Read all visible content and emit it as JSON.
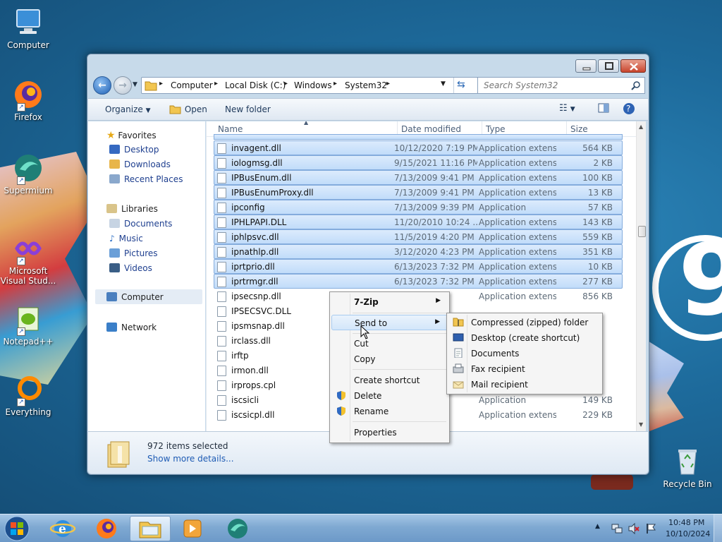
{
  "desktop": {
    "icons": [
      {
        "label": "Computer"
      },
      {
        "label": "Firefox"
      },
      {
        "label": "Supermium"
      },
      {
        "label": "Microsoft Visual Stud..."
      },
      {
        "label": "Notepad++"
      },
      {
        "label": "Everything"
      },
      {
        "label": "Recycle Bin"
      }
    ]
  },
  "window": {
    "breadcrumb": [
      "Computer",
      "Local Disk (C:)",
      "Windows",
      "System32"
    ],
    "search_placeholder": "Search System32",
    "toolbar": {
      "organize": "Organize",
      "open": "Open",
      "new_folder": "New folder"
    },
    "nav": {
      "favorites": "Favorites",
      "favorites_items": [
        "Desktop",
        "Downloads",
        "Recent Places"
      ],
      "libraries": "Libraries",
      "libraries_items": [
        "Documents",
        "Music",
        "Pictures",
        "Videos"
      ],
      "computer": "Computer",
      "network": "Network"
    },
    "columns": {
      "name": "Name",
      "date": "Date modified",
      "type": "Type",
      "size": "Size"
    },
    "rows": [
      {
        "name": "invagent.dll",
        "date": "10/12/2020 7:19 PM",
        "type": "Application extens...",
        "size": "564 KB",
        "selected": true
      },
      {
        "name": "iologmsg.dll",
        "date": "9/15/2021 11:16 PM",
        "type": "Application extens...",
        "size": "2 KB",
        "selected": true
      },
      {
        "name": "IPBusEnum.dll",
        "date": "7/13/2009 9:41 PM",
        "type": "Application extens...",
        "size": "100 KB",
        "selected": true
      },
      {
        "name": "IPBusEnumProxy.dll",
        "date": "7/13/2009 9:41 PM",
        "type": "Application extens...",
        "size": "13 KB",
        "selected": true
      },
      {
        "name": "ipconfig",
        "date": "7/13/2009 9:39 PM",
        "type": "Application",
        "size": "57 KB",
        "selected": true
      },
      {
        "name": "IPHLPAPI.DLL",
        "date": "11/20/2010 10:24 ...",
        "type": "Application extens...",
        "size": "143 KB",
        "selected": true
      },
      {
        "name": "iphlpsvc.dll",
        "date": "11/5/2019 4:20 PM",
        "type": "Application extens...",
        "size": "559 KB",
        "selected": true
      },
      {
        "name": "ipnathlp.dll",
        "date": "3/12/2020 4:23 PM",
        "type": "Application extens...",
        "size": "351 KB",
        "selected": true
      },
      {
        "name": "iprtprio.dll",
        "date": "6/13/2023 7:32 PM",
        "type": "Application extens...",
        "size": "10 KB",
        "selected": true
      },
      {
        "name": "iprtrmgr.dll",
        "date": "6/13/2023 7:32 PM",
        "type": "Application extens...",
        "size": "277 KB",
        "selected": true
      },
      {
        "name": "ipsecsnp.dll",
        "date": "",
        "type": "Application extens...",
        "size": "856 KB",
        "selected": false
      },
      {
        "name": "IPSECSVC.DLL",
        "date": "",
        "type": "",
        "size": "",
        "selected": false
      },
      {
        "name": "ipsmsnap.dll",
        "date": "",
        "type": "",
        "size": "",
        "selected": false
      },
      {
        "name": "irclass.dll",
        "date": "",
        "type": "",
        "size": "",
        "selected": false
      },
      {
        "name": "irftp",
        "date": "",
        "type": "",
        "size": "",
        "selected": false
      },
      {
        "name": "irmon.dll",
        "date": "",
        "type": "",
        "size": "",
        "selected": false
      },
      {
        "name": "irprops.cpl",
        "date": "",
        "type": "",
        "size": "",
        "selected": false
      },
      {
        "name": "iscsicli",
        "date": "AM",
        "type": "Application",
        "size": "149 KB",
        "selected": false
      },
      {
        "name": "iscsicpl.dll",
        "date": "PM",
        "type": "Application extens...",
        "size": "229 KB",
        "selected": false
      }
    ],
    "details": {
      "count": "972 items selected",
      "more": "Show more details..."
    }
  },
  "context_menu": {
    "items": [
      "7-Zip",
      "Send to",
      "Cut",
      "Copy",
      "Create shortcut",
      "Delete",
      "Rename",
      "Properties"
    ]
  },
  "sendto_menu": {
    "items": [
      "Compressed (zipped) folder",
      "Desktop (create shortcut)",
      "Documents",
      "Fax recipient",
      "Mail recipient"
    ]
  },
  "taskbar": {
    "time": "10:48 PM",
    "date": "10/10/2024"
  },
  "colors": {
    "selection": "#c1dcfa",
    "selection_border": "#84acdd",
    "link": "#1e3f8f"
  }
}
